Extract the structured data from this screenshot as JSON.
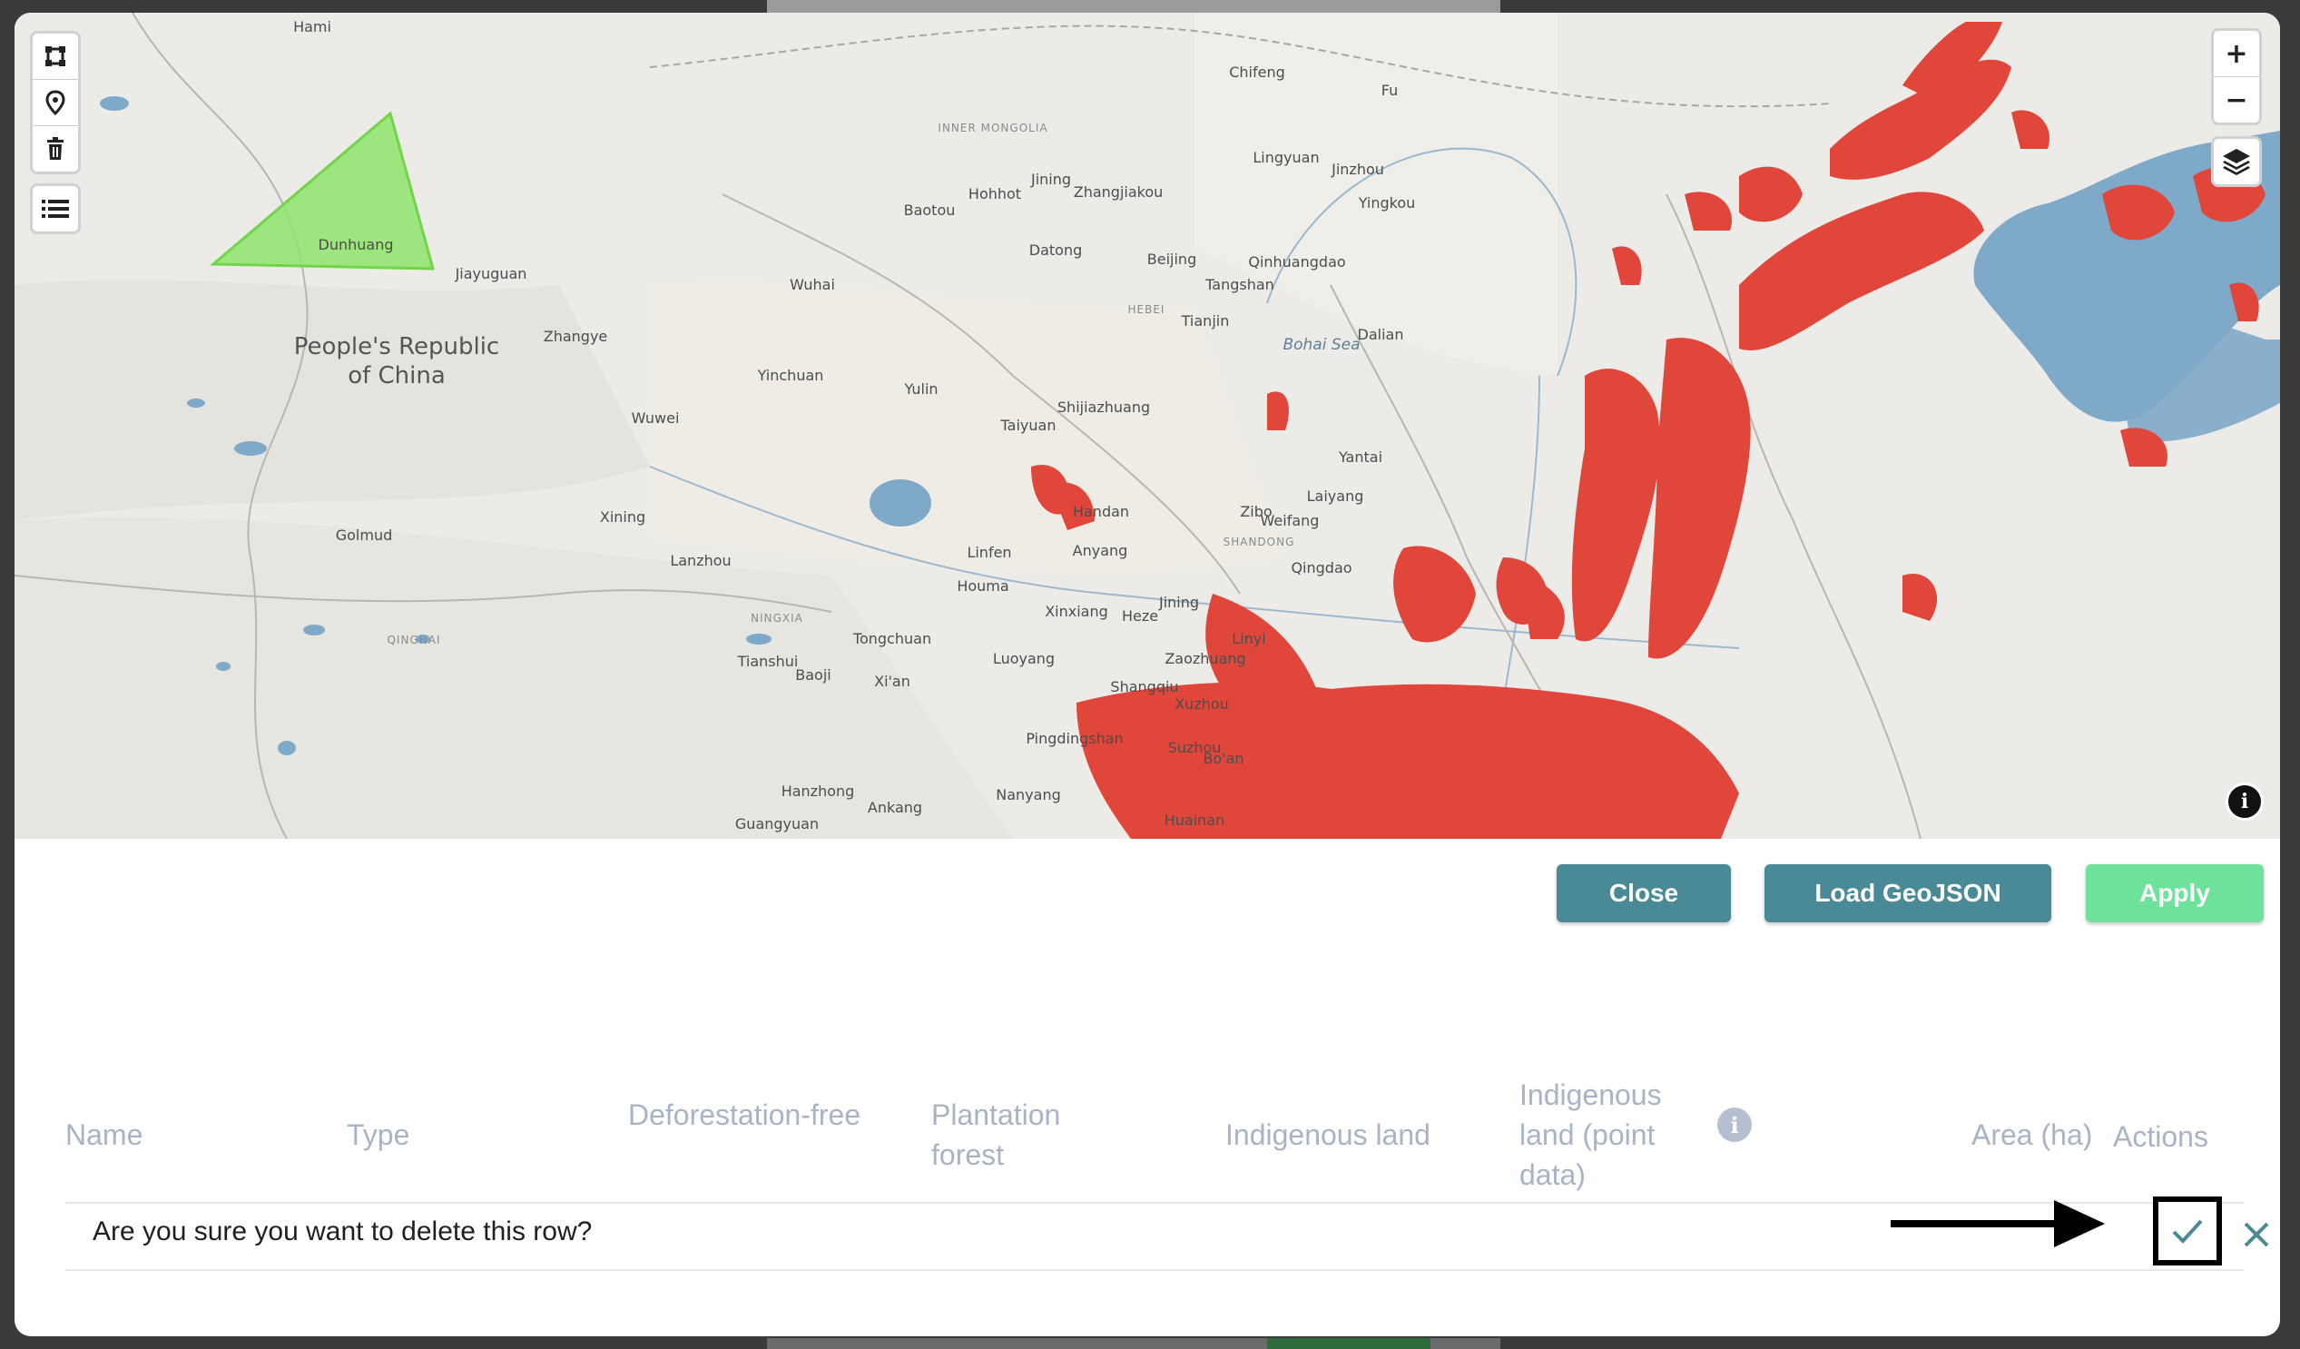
{
  "map": {
    "labels": {
      "country": "People's Republic of China",
      "sea": "Bohai Sea",
      "regions": [
        "INNER MONGOLIA",
        "QINGHAI",
        "NINGXIA",
        "HEBEI",
        "SHANDONG"
      ],
      "cities": [
        "Hami",
        "Dunhuang",
        "Jiayuguan",
        "Zhangye",
        "Wuwei",
        "Xining",
        "Golmud",
        "Lanzhou",
        "Wuhai",
        "Yinchuan",
        "Baotou",
        "Hohhot",
        "Jining",
        "Zhangjiakou",
        "Datong",
        "Beijing",
        "Chifeng",
        "Lingyuan",
        "Jinzhou",
        "Yingkou",
        "Qinhuangdao",
        "Tangshan",
        "Tianjin",
        "Dalian",
        "Yulin",
        "Taiyuan",
        "Shijiazhuang",
        "Handan",
        "Anyang",
        "Linfen",
        "Houma",
        "Tongchuan",
        "Xi'an",
        "Baoji",
        "Tianshui",
        "Luoyang",
        "Xinxiang",
        "Heze",
        "Jining",
        "Zibo",
        "Weifang",
        "Yantai",
        "Laiyang",
        "Qingdao",
        "Linyi",
        "Zaozhuang",
        "Xuzhou",
        "Shangqiu",
        "Suzhou",
        "Pingdingshan",
        "Nanyang",
        "Hanzhong",
        "Ankang",
        "Guangyuan",
        "Huainan",
        "Bo'an",
        "Fu"
      ]
    },
    "controls": {
      "draw_polygon": "draw-polygon",
      "draw_marker": "map-marker",
      "delete": "trash",
      "layers_list": "list",
      "zoom_in": "+",
      "zoom_out": "−",
      "layers": "layers",
      "info": "i"
    },
    "colors": {
      "polygon_fill": "#8fe46b",
      "deforestation": "#e0463a",
      "water": "#7fa9c9"
    }
  },
  "buttons": {
    "close": "Close",
    "load_geojson": "Load GeoJSON",
    "apply": "Apply"
  },
  "table": {
    "headers": {
      "name": "Name",
      "type": "Type",
      "deforestation_free": "Deforestation-free",
      "plantation_forest": "Plantation forest",
      "indigenous_land": "Indigenous land",
      "indigenous_land_point": "Indigenous land (point data)",
      "area": "Area (ha)",
      "actions": "Actions"
    },
    "confirm_row": {
      "message": "Are you sure you want to delete this row?",
      "confirm_icon": "check",
      "cancel_icon": "close"
    }
  }
}
